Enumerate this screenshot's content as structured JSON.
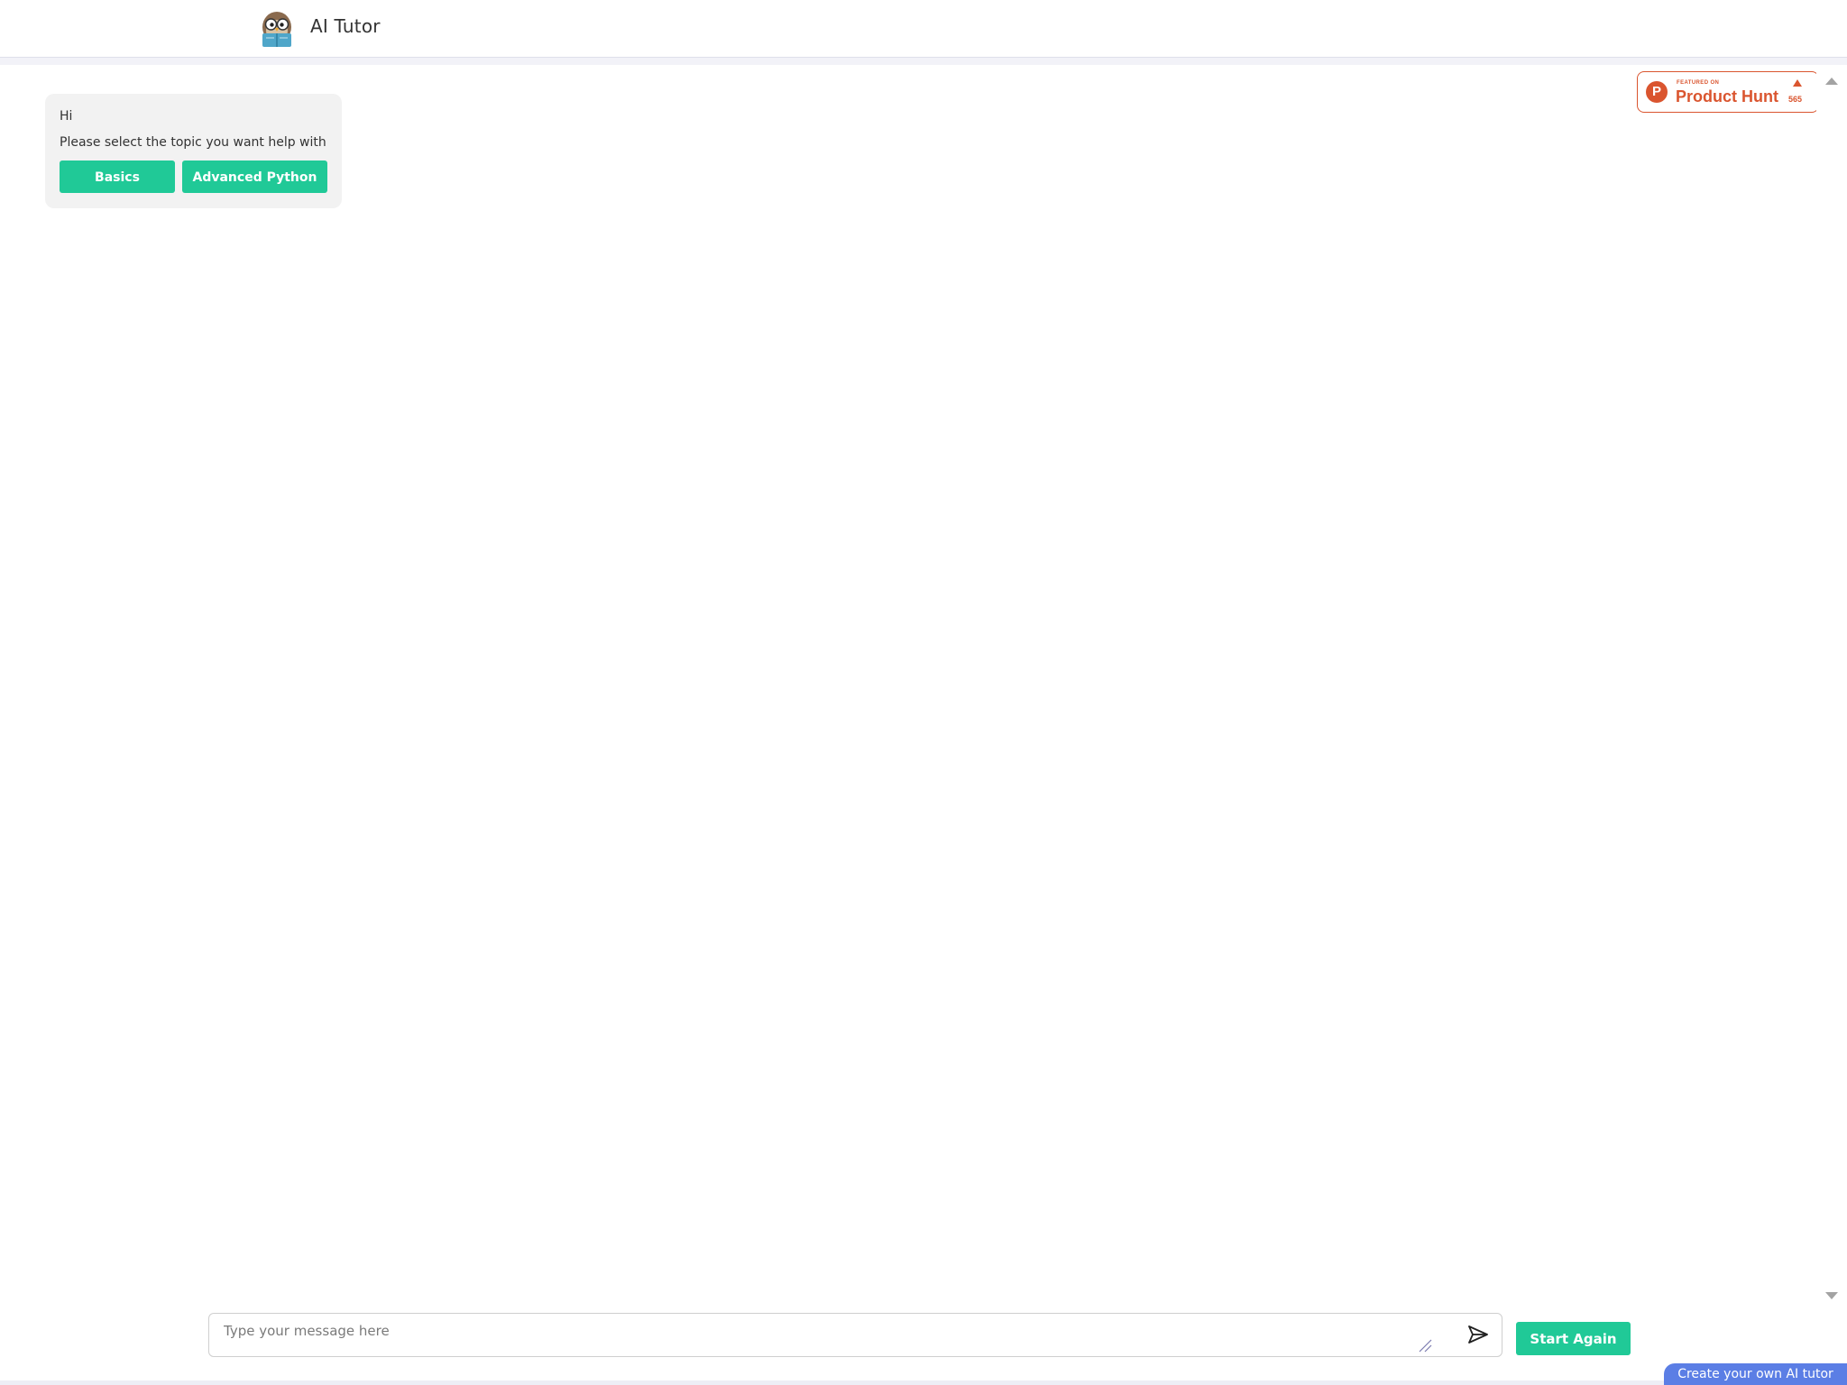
{
  "header": {
    "title": "AI Tutor",
    "logo_icon": "owl-reading-book-icon"
  },
  "chat": {
    "greeting": "Hi",
    "prompt": "Please select the topic you want help with",
    "options": [
      {
        "label": "Basics"
      },
      {
        "label": "Advanced Python"
      }
    ]
  },
  "product_hunt_badge": {
    "featured_text": "FEATURED ON",
    "name": "Product Hunt",
    "logo_letter": "P",
    "upvote_count": "565",
    "color": "#da552f"
  },
  "composer": {
    "placeholder": "Type your message here",
    "send_icon": "send-paper-plane-icon",
    "start_again_label": "Start Again"
  },
  "footer": {
    "create_label": "Create your own AI tutor"
  },
  "colors": {
    "accent": "#20c997",
    "tab_blue": "#5b7ee5",
    "bubble_bg": "#f2f2f2"
  }
}
